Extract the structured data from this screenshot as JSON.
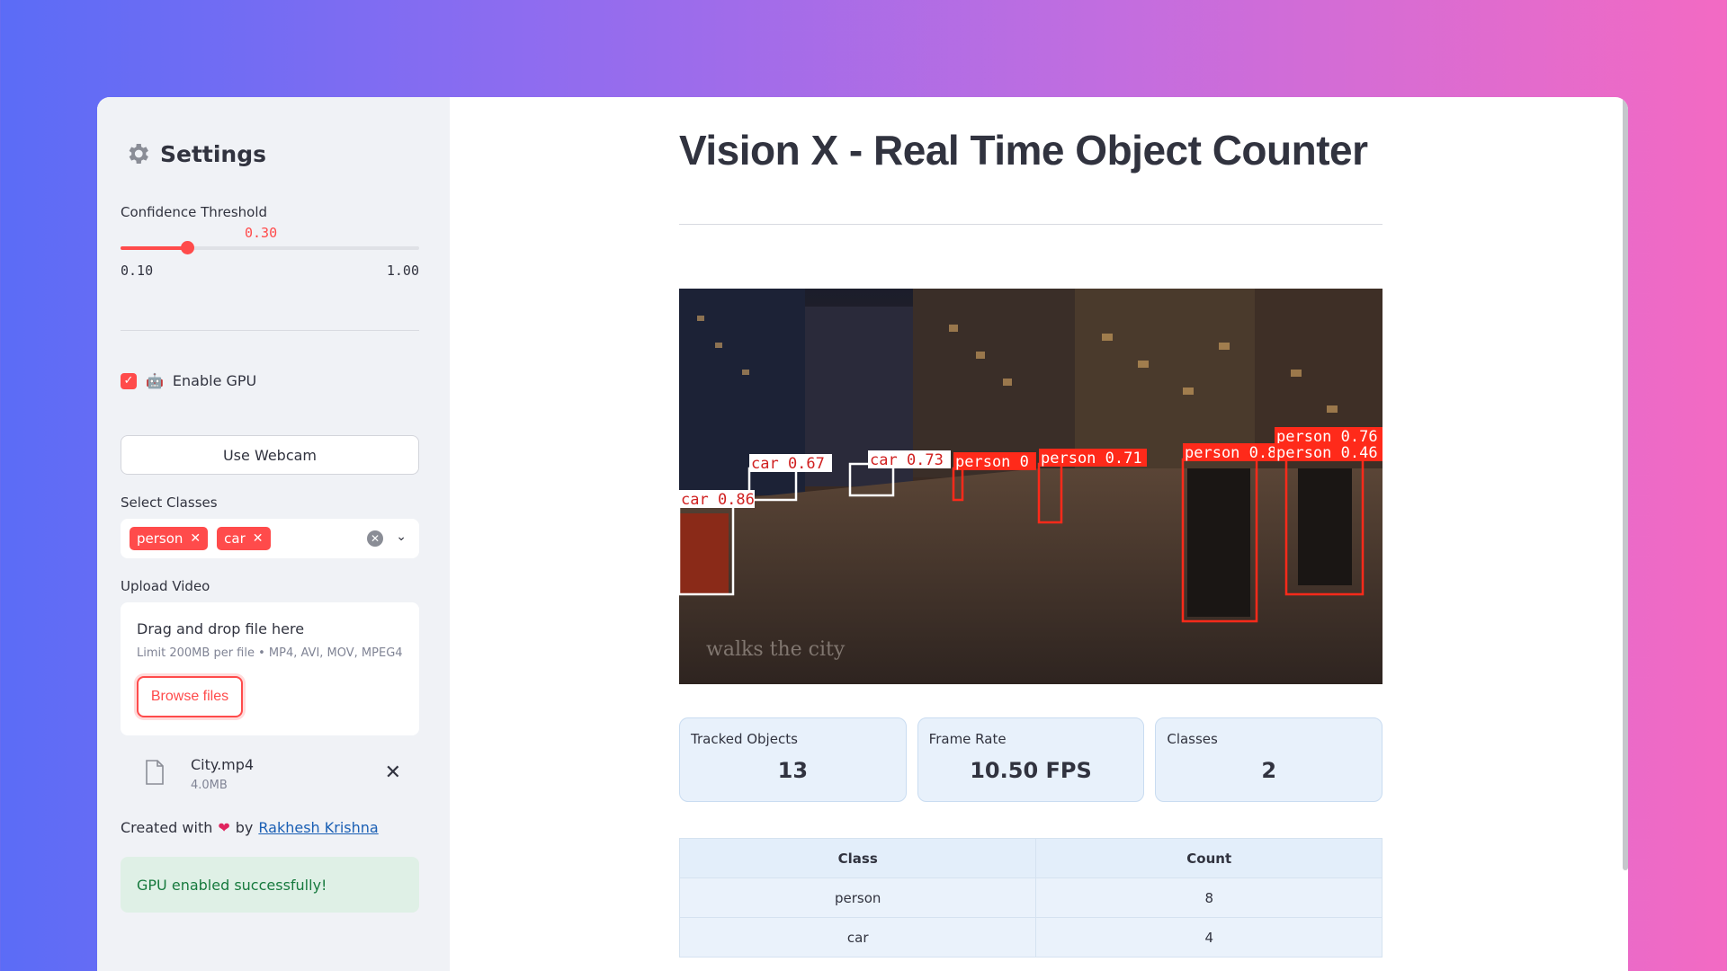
{
  "sidebar": {
    "title": "Settings",
    "confidence": {
      "label": "Confidence Threshold",
      "value": "0.30",
      "min": "0.10",
      "max": "1.00",
      "fraction": 0.222
    },
    "gpu": {
      "label": "Enable GPU",
      "checked": true
    },
    "webcam_button": "Use Webcam",
    "select_classes": {
      "label": "Select Classes",
      "tags": [
        "person",
        "car"
      ]
    },
    "upload": {
      "label": "Upload Video",
      "drag_text": "Drag and drop file here",
      "limit_text": "Limit 200MB per file • MP4, AVI, MOV, MPEG4",
      "browse_button": "Browse files",
      "file": {
        "name": "City.mp4",
        "size": "4.0MB"
      }
    },
    "credit": {
      "prefix": "Created with",
      "by": "by",
      "author": "Rakhesh Krishna"
    },
    "success_message": "GPU enabled successfully!"
  },
  "main": {
    "title": "Vision X - Real Time Object Counter",
    "video_watermark": "walks the city",
    "detections": [
      {
        "label": "car 0.86"
      },
      {
        "label": "car 0.67"
      },
      {
        "label": "car 0.73"
      },
      {
        "label": "person 0"
      },
      {
        "label": "person 0.71"
      },
      {
        "label": "person 0.88"
      },
      {
        "label": "person 0.76"
      },
      {
        "label": "person 0.46"
      }
    ],
    "metrics": [
      {
        "label": "Tracked Objects",
        "value": "13"
      },
      {
        "label": "Frame Rate",
        "value": "10.50 FPS"
      },
      {
        "label": "Classes",
        "value": "2"
      }
    ],
    "table": {
      "headers": [
        "Class",
        "Count"
      ],
      "rows": [
        [
          "person",
          "8"
        ],
        [
          "car",
          "4"
        ]
      ]
    }
  },
  "colors": {
    "accent": "#ff4b4b",
    "success_bg": "#dff0e6",
    "metric_bg": "#e8f1fb"
  }
}
